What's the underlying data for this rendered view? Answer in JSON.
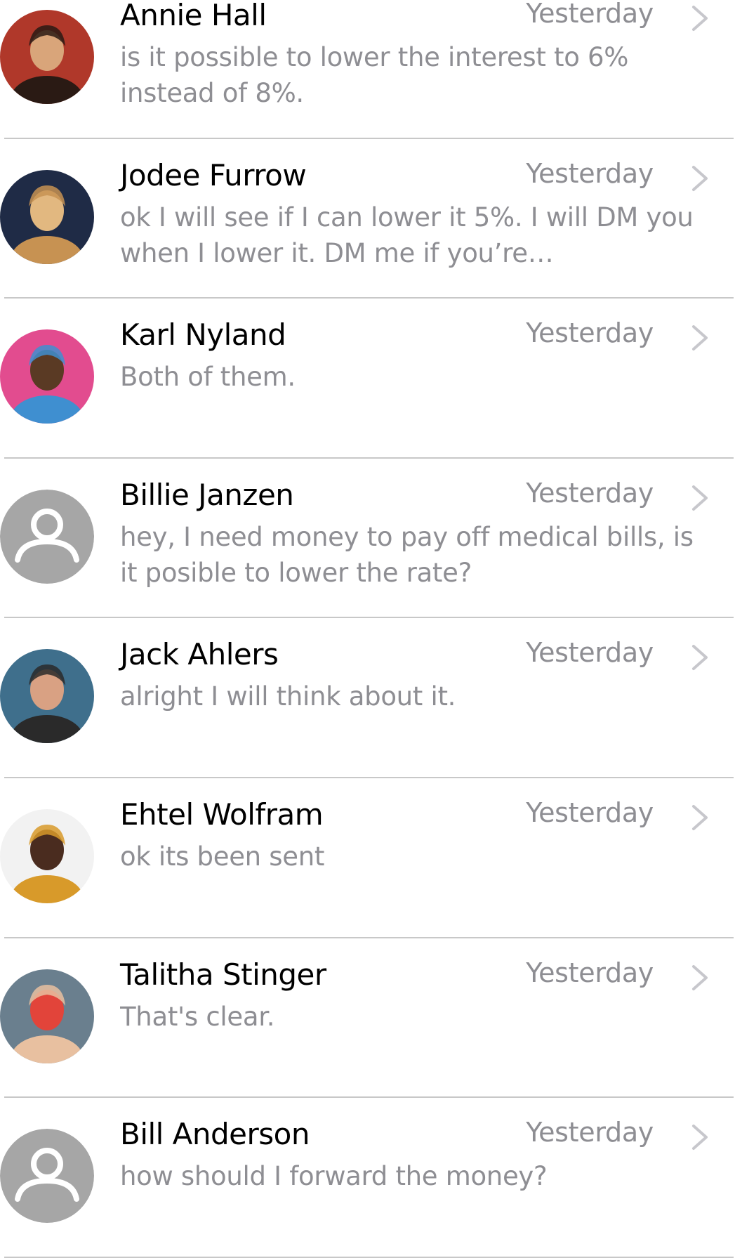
{
  "conversations": [
    {
      "name": "Annie Hall",
      "time": "Yesterday",
      "message": "is it possible to lower the interest to 6% instead of 8%.",
      "avatar": "photo",
      "avatar_colors": [
        "#b0382a",
        "#d9a57a",
        "#2a1a14"
      ]
    },
    {
      "name": "Jodee Furrow",
      "time": "Yesterday",
      "message": "ok I will see if I can lower it 5%. I will DM you when I lower it. DM me if you’re…",
      "avatar": "photo",
      "avatar_colors": [
        "#1f2b46",
        "#e2b880",
        "#c79252"
      ]
    },
    {
      "name": "Karl Nyland",
      "time": "Yesterday",
      "message": "Both of them.",
      "avatar": "photo",
      "avatar_colors": [
        "#e24c8f",
        "#5a3a24",
        "#3f8fd0"
      ]
    },
    {
      "name": "Billie Janzen",
      "time": "Yesterday",
      "message": "hey, I need money to pay off medical bills, is it posible to lower the rate?",
      "avatar": "placeholder",
      "avatar_colors": [
        "#a6a6a6",
        "#ffffff",
        "#ffffff"
      ]
    },
    {
      "name": "Jack Ahlers",
      "time": "Yesterday",
      "message": "alright I will think about it.",
      "avatar": "photo",
      "avatar_colors": [
        "#3f6f8c",
        "#d9a183",
        "#2a2a2a"
      ]
    },
    {
      "name": "Ehtel Wolfram",
      "time": "Yesterday",
      "message": "ok its been sent",
      "avatar": "photo",
      "avatar_colors": [
        "#f2f2f2",
        "#4a2c1f",
        "#d89a2a"
      ]
    },
    {
      "name": "Talitha Stinger",
      "time": "Yesterday",
      "message": "That's clear.",
      "avatar": "photo",
      "avatar_colors": [
        "#6a7f8e",
        "#e2443a",
        "#e8c0a0"
      ]
    },
    {
      "name": "Bill Anderson",
      "time": "Yesterday",
      "message": "how should I forward the money?",
      "avatar": "placeholder",
      "avatar_colors": [
        "#a6a6a6",
        "#ffffff",
        "#ffffff"
      ]
    }
  ],
  "colors": {
    "name_text": "#000000",
    "secondary_text": "#8e8e93",
    "divider": "#c8c8c8",
    "chevron": "#c7c7cc",
    "placeholder_bg": "#a6a6a6"
  },
  "icons": {
    "chevron": "chevron-right-icon",
    "placeholder": "user-placeholder-icon"
  }
}
